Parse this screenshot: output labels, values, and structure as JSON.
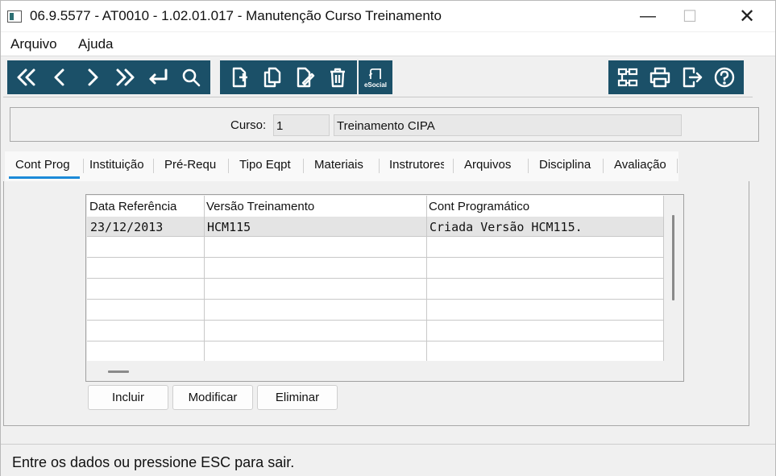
{
  "window": {
    "title": "06.9.5577 - AT0010 - 1.02.01.017 - Manutenção Curso Treinamento",
    "minimize_glyph": "—",
    "maximize_glyph": "☐",
    "close_glyph": "✕"
  },
  "menu": {
    "items": [
      {
        "label": "Arquivo"
      },
      {
        "label": "Ajuda"
      }
    ]
  },
  "toolbar": {
    "nav_icons": [
      "first-record-icon",
      "previous-record-icon",
      "next-record-icon",
      "last-record-icon",
      "return-icon",
      "search-icon"
    ],
    "edit_icons": [
      "new-record-icon",
      "copy-record-icon",
      "edit-record-icon",
      "delete-icon"
    ],
    "esocial_label": "eSocial",
    "right_icons": [
      "structure-icon",
      "print-icon",
      "exit-icon",
      "help-icon"
    ],
    "accent_color": "#1b5068"
  },
  "header": {
    "course_label": "Curso:",
    "course_code": "1",
    "course_name": "Treinamento CIPA"
  },
  "tabs": [
    {
      "label": "Cont Prog",
      "active": true
    },
    {
      "label": "Instituição"
    },
    {
      "label": "Pré-Requ"
    },
    {
      "label": "Tipo Eqpt"
    },
    {
      "label": "Materiais"
    },
    {
      "label": "Instrutores"
    },
    {
      "label": "Arquivos"
    },
    {
      "label": "Disciplina"
    },
    {
      "label": "Avaliação"
    }
  ],
  "grid": {
    "columns": [
      "Data Referência",
      "Versão Treinamento",
      "Cont Programático"
    ],
    "rows": [
      [
        "23/12/2013",
        "HCM115",
        "Criada Versão HCM115."
      ]
    ]
  },
  "actions": {
    "include_label": "Incluir",
    "modify_label": "Modificar",
    "delete_label": "Eliminar"
  },
  "status": {
    "message": "Entre os dados ou pressione ESC para sair."
  }
}
